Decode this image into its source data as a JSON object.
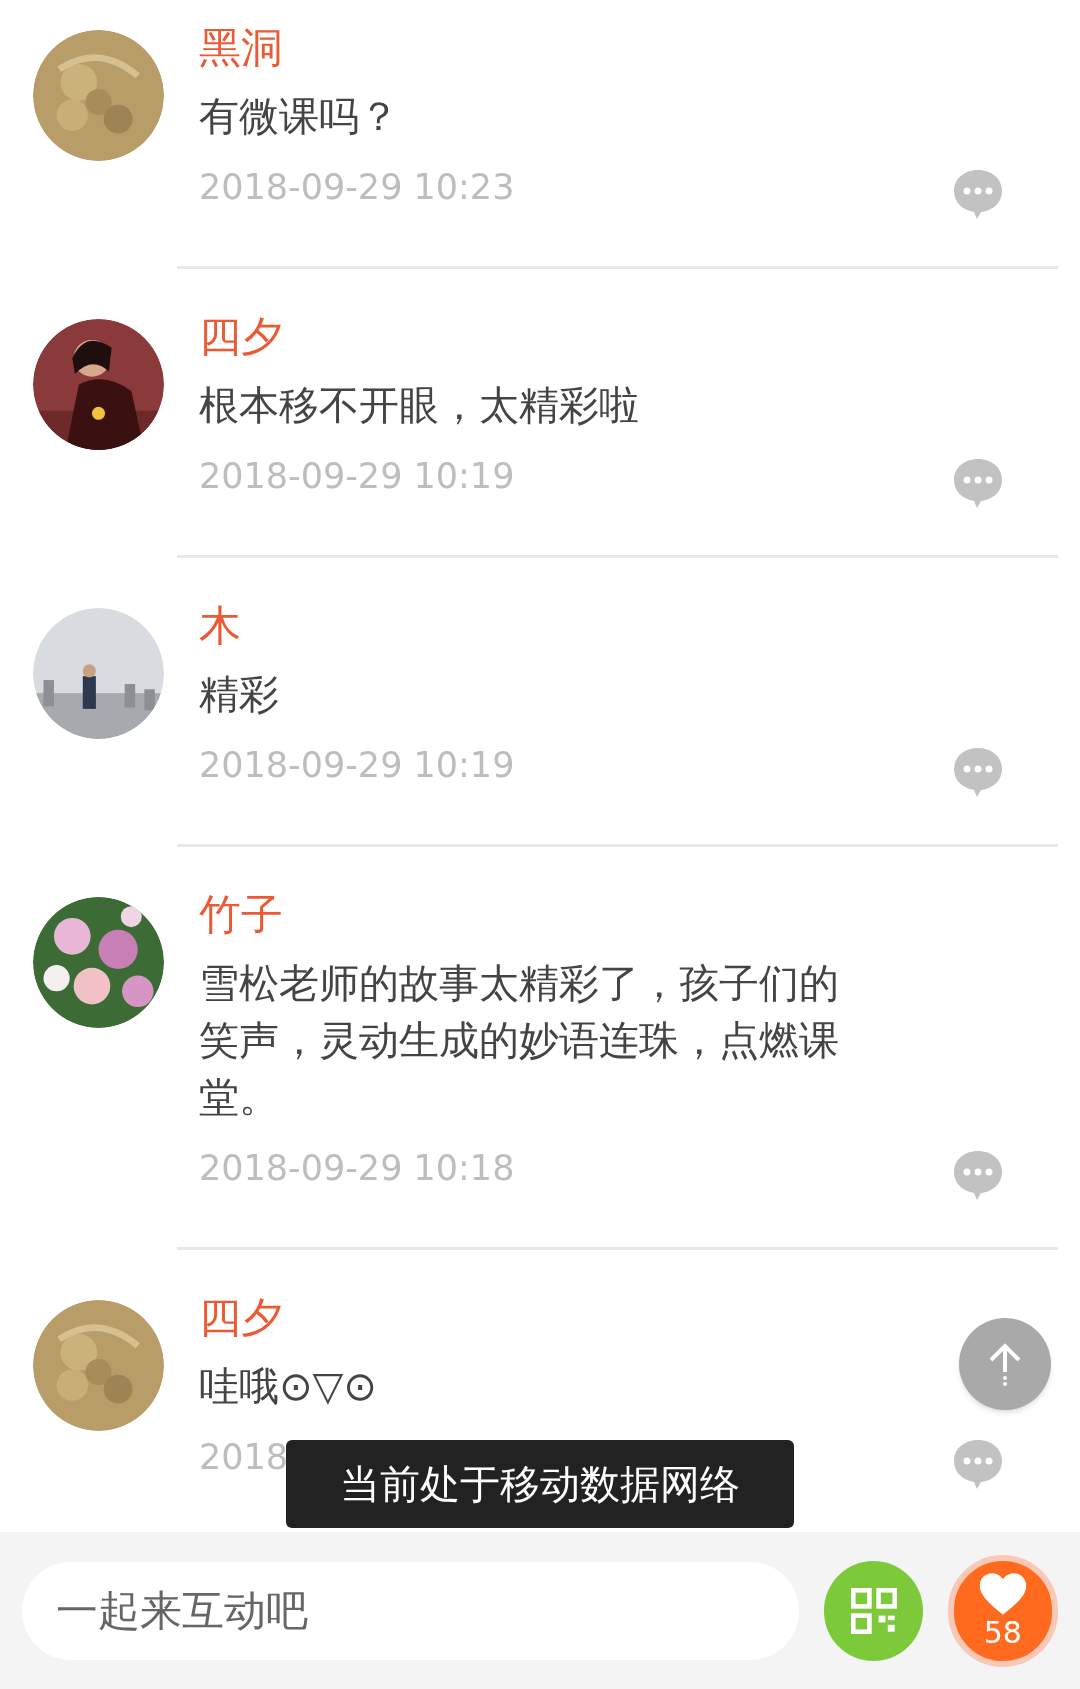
{
  "comments": [
    {
      "name": "黑洞",
      "text": "有微课吗？",
      "time": "2018-09-29 10:23"
    },
    {
      "name": "四夕",
      "text": "根本移不开眼，太精彩啦",
      "time": "2018-09-29 10:19"
    },
    {
      "name": "木",
      "text": "精彩",
      "time": "2018-09-29 10:19"
    },
    {
      "name": "竹子",
      "text": "雪松老师的故事太精彩了，孩子们的笑声，灵动生成的妙语连珠，点燃课堂。",
      "time": "2018-09-29 10:18"
    },
    {
      "name": "四夕",
      "text": "哇哦⊙▽⊙",
      "time": "2018"
    }
  ],
  "toast": "当前处于移动数据网络",
  "input": {
    "placeholder": "一起来互动吧"
  },
  "likes": "58"
}
